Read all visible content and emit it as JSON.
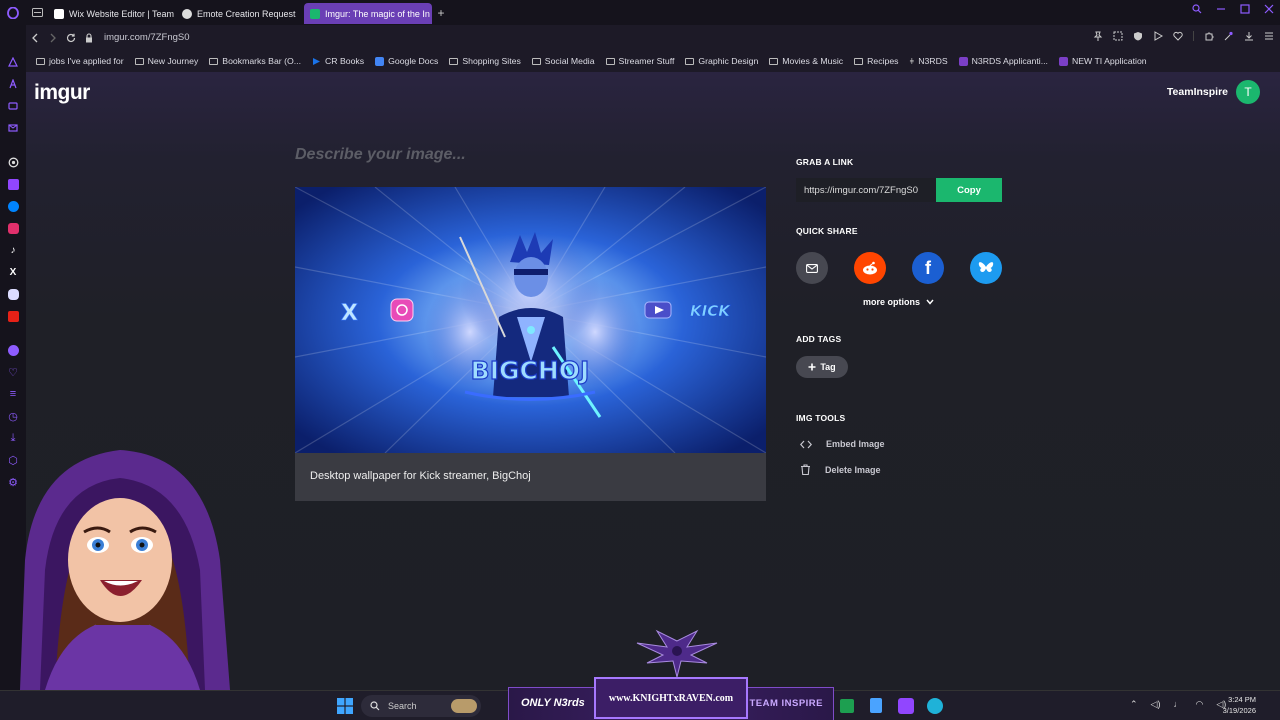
{
  "browser": {
    "tabs": [
      {
        "label": "Wix Website Editor | Team",
        "fav_color": "#ffffff"
      },
      {
        "label": "Emote Creation Request",
        "fav_color": "#dddddd"
      },
      {
        "label": "Imgur: The magic of the In",
        "fav_color": "#1bb76e",
        "active": true
      }
    ],
    "url": "imgur.com/7ZFngS0",
    "bookmarks": [
      "jobs I've applied for",
      "New Journey",
      "Bookmarks Bar (O...",
      "CR Books",
      "Google Docs",
      "Shopping Sites",
      "Social Media",
      "Streamer Stuff",
      "Graphic Design",
      "Movies & Music",
      "Recipes",
      "N3RDS",
      "N3RDS Applicanti...",
      "NEW TI Application"
    ]
  },
  "imgur": {
    "logo": "imgur",
    "username": "TeamInspire",
    "avatar_letter": "T",
    "describe_placeholder": "Describe your image...",
    "caption": "Desktop wallpaper for Kick streamer, BigChoj",
    "image_text": {
      "title": "BIGCHOJ",
      "left_platform": "X",
      "right_platform": "KICK"
    },
    "grab_link_label": "GRAB A LINK",
    "link": "https://imgur.com/7ZFngS0",
    "copy_label": "Copy",
    "quick_share_label": "QUICK SHARE",
    "share_icons": [
      "email-icon",
      "reddit-icon",
      "facebook-icon",
      "bluesky-icon"
    ],
    "more_options_label": "more options",
    "add_tags_label": "ADD TAGS",
    "tag_label": "Tag",
    "img_tools_label": "IMG TOOLS",
    "embed_label": "Embed Image",
    "delete_label": "Delete Image",
    "accent": "#1bb76e"
  },
  "taskbar": {
    "search_label": "Search",
    "brand_left": "ONLY N3rds",
    "brand_center": "www.KNIGHTxRAVEN.com",
    "brand_right": "TEAM INSPIRE",
    "time": "3:24 PM",
    "date": "3/19/2026"
  }
}
